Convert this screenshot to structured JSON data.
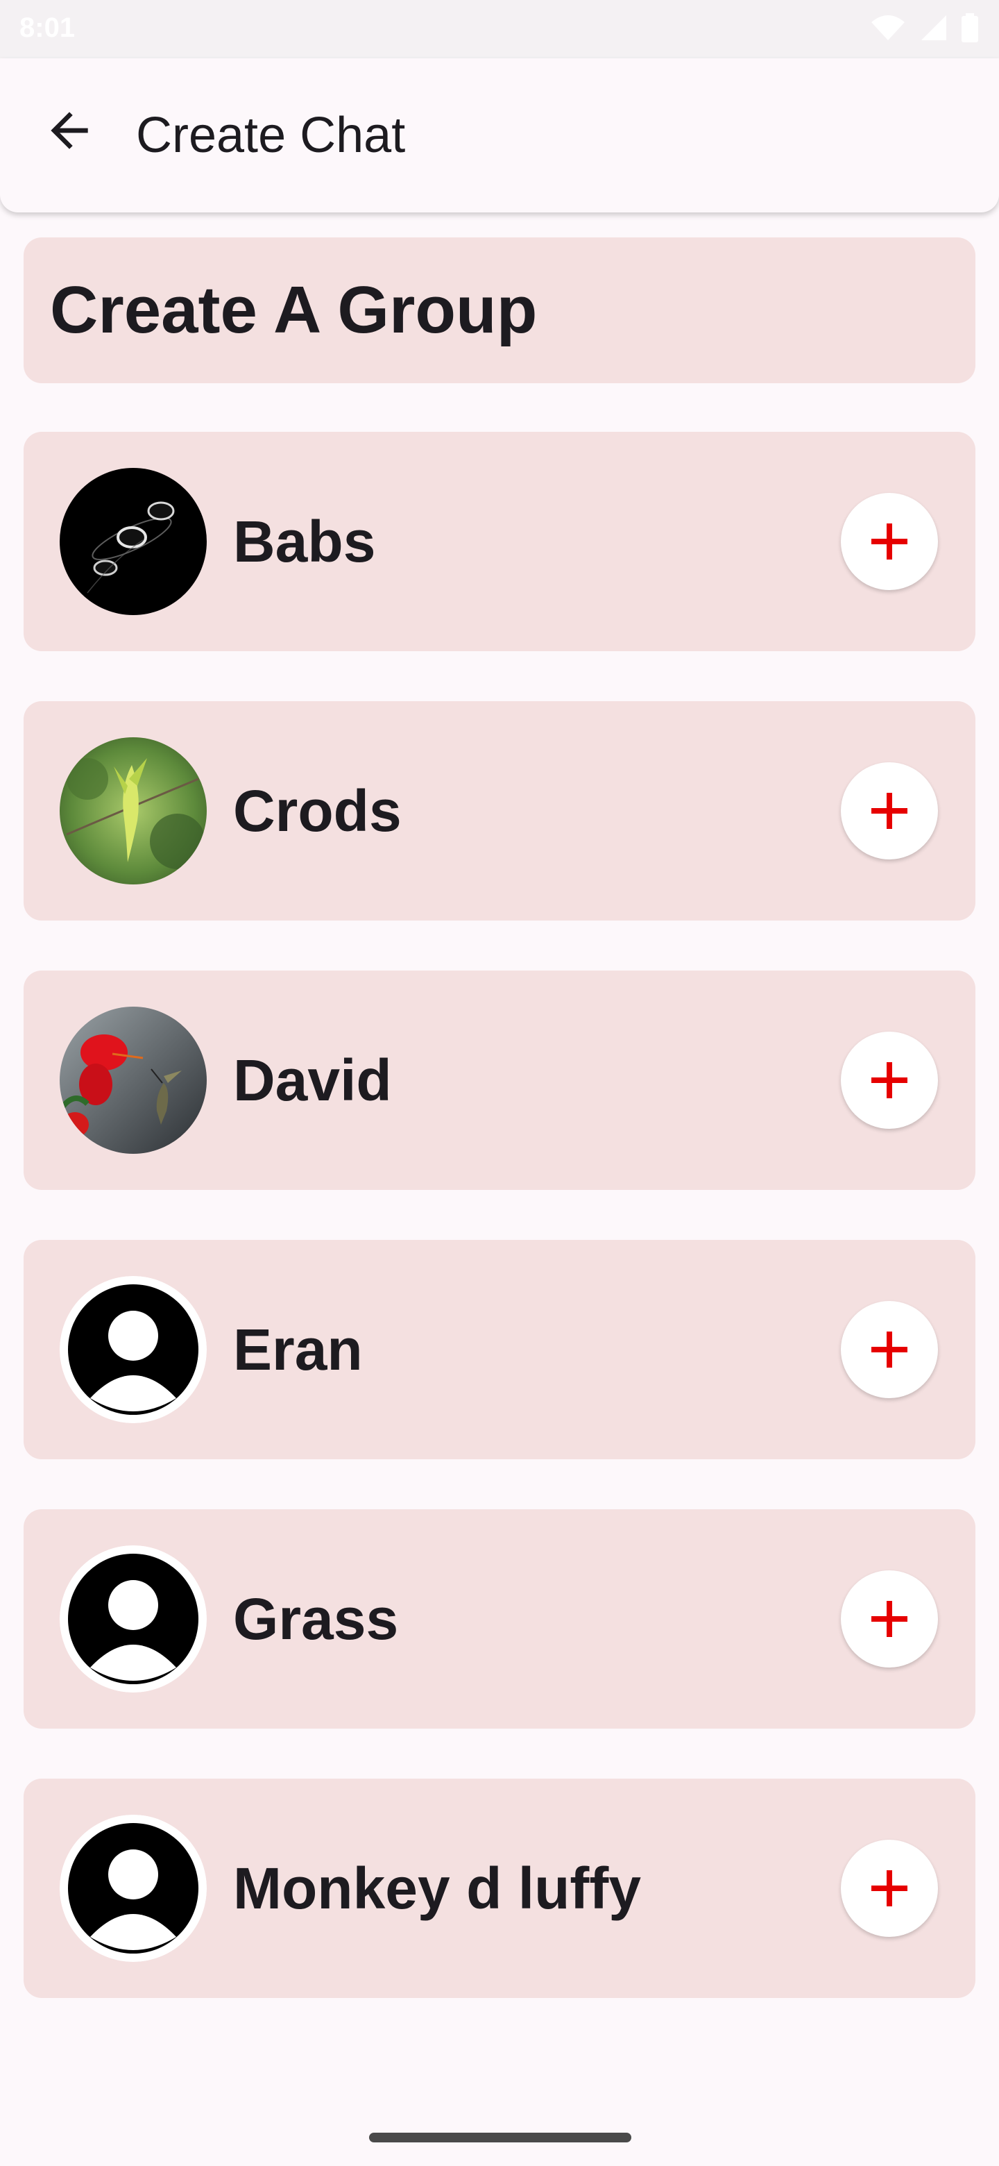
{
  "status_bar": {
    "time": "8:01",
    "icons": [
      "wifi-icon",
      "signal-icon",
      "battery-icon"
    ]
  },
  "app_bar": {
    "title": "Create Chat",
    "back_icon": "arrow-back-icon"
  },
  "group_card": {
    "title": "Create A Group"
  },
  "contacts": [
    {
      "name": "Babs",
      "avatar": "eclipse-photo"
    },
    {
      "name": "Crods",
      "avatar": "bird-photo"
    },
    {
      "name": "David",
      "avatar": "hummingbird-hibiscus-photo"
    },
    {
      "name": "Eran",
      "avatar": "default-person-avatar"
    },
    {
      "name": "Grass",
      "avatar": "default-person-avatar"
    },
    {
      "name": "Monkey d luffy",
      "avatar": "default-person-avatar"
    }
  ],
  "add_button_icon": "plus-icon",
  "colors": {
    "background": "#fdf8fb",
    "card": "#f4e0e0",
    "text": "#1d1b20",
    "accent_plus": "#e60000"
  }
}
